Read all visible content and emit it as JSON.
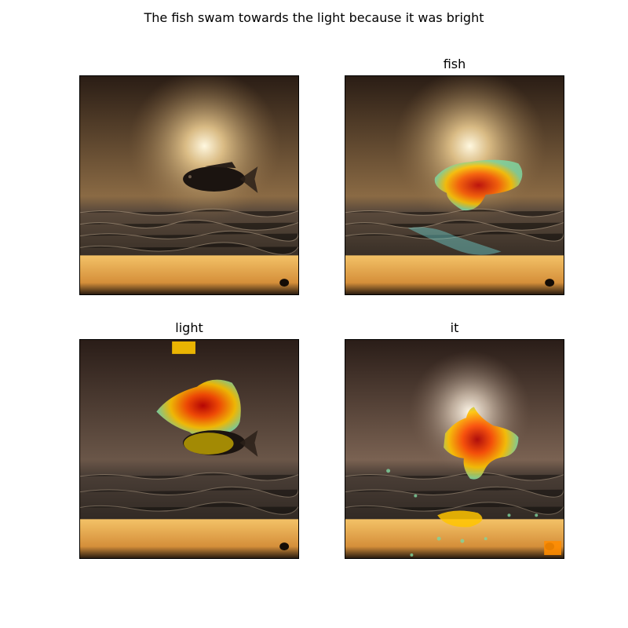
{
  "suptitle": "The fish swam towards the light because it was bright",
  "panels": [
    {
      "title": "",
      "overlay": "none"
    },
    {
      "title": "fish",
      "overlay": "heatmap"
    },
    {
      "title": "light",
      "overlay": "heatmap"
    },
    {
      "title": "it",
      "overlay": "heatmap"
    }
  ],
  "colors": {
    "sky_top": "#2a1f17",
    "glow": "#fff6d8",
    "sea": "#2b2622",
    "platform": "#e6a94a",
    "heat_hot": "#c00000",
    "heat_mid": "#ff9a00",
    "heat_edge": "#7fd6a0"
  }
}
